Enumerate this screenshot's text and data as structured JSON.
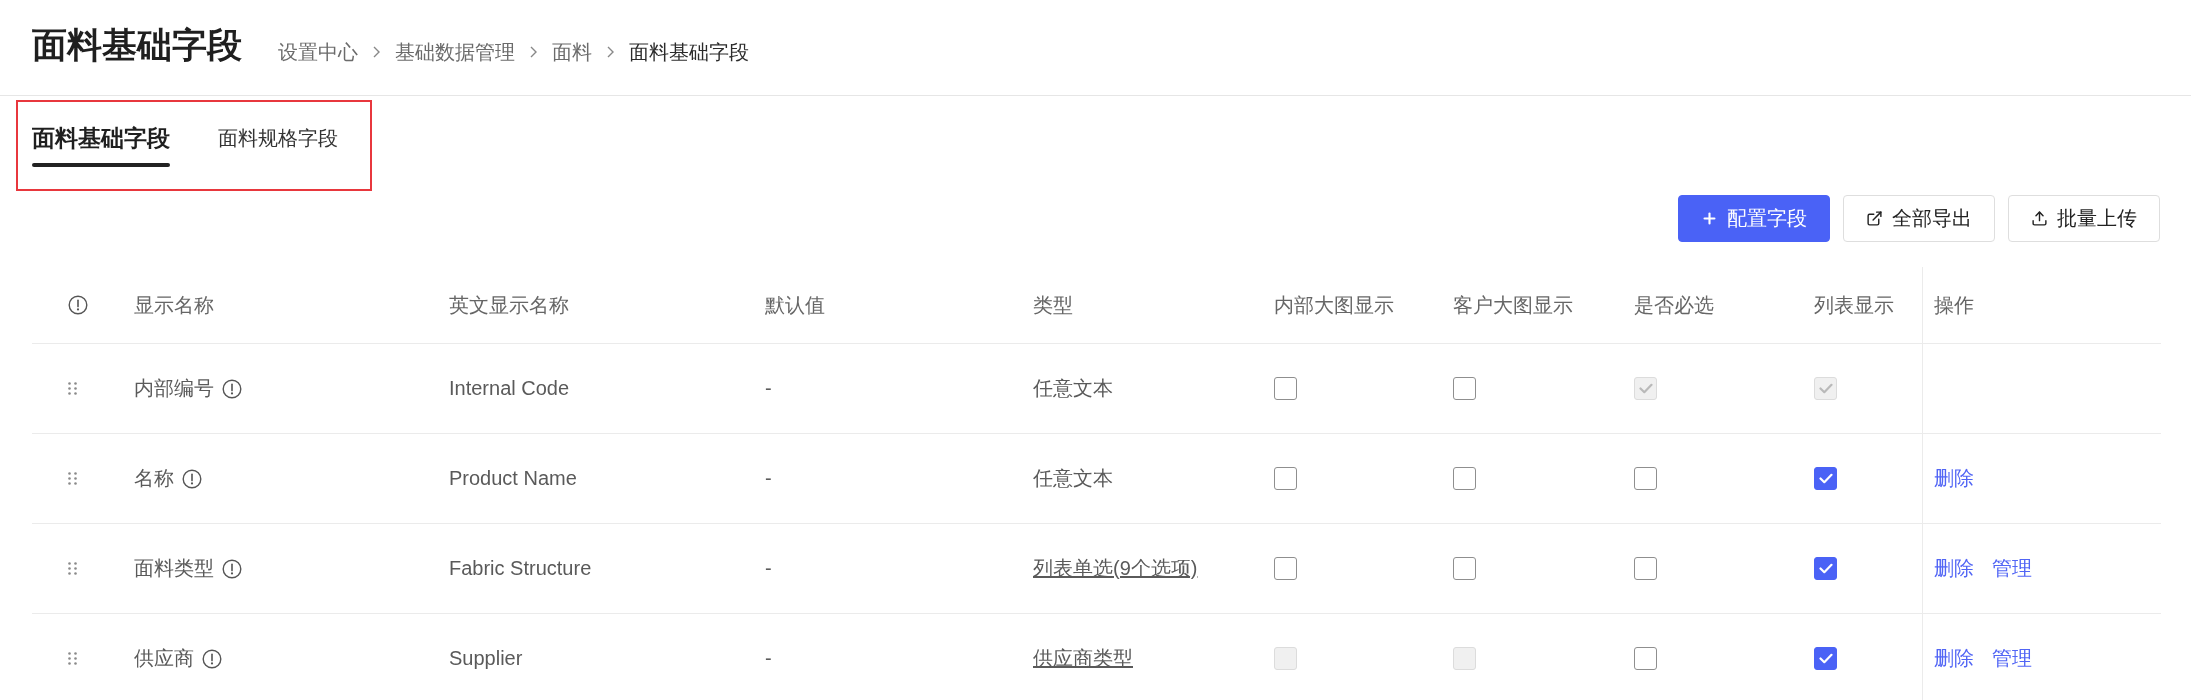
{
  "page": {
    "title": "面料基础字段",
    "breadcrumb": [
      {
        "label": "设置中心",
        "current": false
      },
      {
        "label": "基础数据管理",
        "current": false
      },
      {
        "label": "面料",
        "current": false
      },
      {
        "label": "面料基础字段",
        "current": true
      }
    ]
  },
  "tab_bar": {
    "highlighted": true,
    "tabs": [
      {
        "label": "面料基础字段",
        "selected": true
      },
      {
        "label": "面料规格字段",
        "selected": false
      }
    ]
  },
  "toolbar": {
    "buttons": [
      {
        "label": "配置字段",
        "kind": "add"
      },
      {
        "label": "全部导出",
        "kind": "export"
      },
      {
        "label": "批量上传",
        "kind": "upload"
      }
    ]
  },
  "table": {
    "columns": [
      {
        "label": "显示名称"
      },
      {
        "label": "英文显示名称"
      },
      {
        "label": "默认值"
      },
      {
        "label": "类型"
      },
      {
        "label": "内部大图显示"
      },
      {
        "label": "客户大图显示"
      },
      {
        "label": "是否必选"
      },
      {
        "label": "列表显示"
      },
      {
        "label": "操作"
      }
    ],
    "rows": [
      {
        "name": "内部编号",
        "english_name": "Internal Code",
        "default_value": "-",
        "type": {
          "text": "任意文本",
          "kind": "plain"
        },
        "checkboxes": [
          {
            "checked": false,
            "disabled": false
          },
          {
            "checked": false,
            "disabled": false
          },
          {
            "checked": true,
            "disabled": true
          },
          {
            "checked": true,
            "disabled": true
          }
        ]
      },
      {
        "name": "名称",
        "english_name": "Product Name",
        "default_value": "-",
        "type": {
          "text": "任意文本",
          "kind": "plain"
        },
        "checkboxes": [
          {
            "checked": false,
            "disabled": false
          },
          {
            "checked": false,
            "disabled": false
          },
          {
            "checked": false,
            "disabled": false
          },
          {
            "checked": true,
            "disabled": false
          }
        ],
        "actions": [
          "删除"
        ]
      },
      {
        "name": "面料类型",
        "english_name": "Fabric Structure",
        "default_value": "-",
        "type": {
          "text": "列表单选(9个选项)",
          "kind": "link"
        },
        "checkboxes": [
          {
            "checked": false,
            "disabled": false
          },
          {
            "checked": false,
            "disabled": false
          },
          {
            "checked": false,
            "disabled": false
          },
          {
            "checked": true,
            "disabled": false
          }
        ],
        "actions": [
          "删除",
          "管理"
        ]
      },
      {
        "name": "供应商",
        "english_name": "Supplier",
        "default_value": "-",
        "type": {
          "text": "供应商类型",
          "kind": "link"
        },
        "checkboxes": [
          {
            "checked": false,
            "disabled": true
          },
          {
            "checked": false,
            "disabled": true
          },
          {
            "checked": false,
            "disabled": false
          },
          {
            "checked": true,
            "disabled": false
          }
        ],
        "actions": [
          "删除",
          "管理"
        ]
      }
    ]
  }
}
